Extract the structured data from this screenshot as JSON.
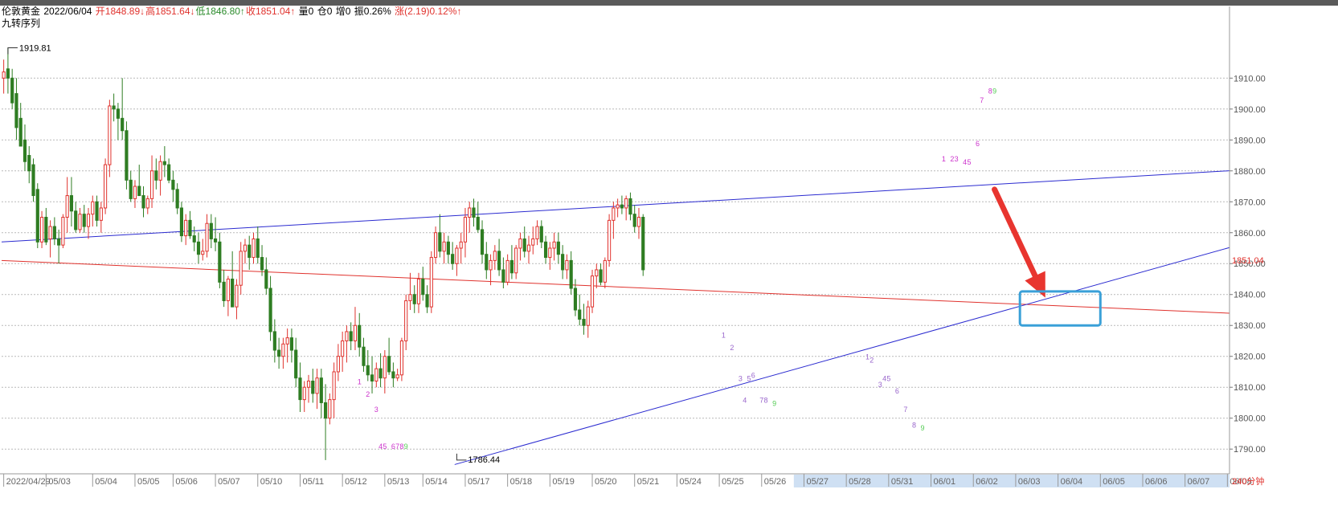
{
  "header": {
    "symbol": "伦敦黄金",
    "date": "2022/06/04",
    "open": "开1848.89↓",
    "high": "高1851.64↓",
    "low": "低1846.80↑",
    "close": "收1851.04↑",
    "volume": "量0",
    "position": "仓0",
    "increase": "增0",
    "amplitude": "振0.26%",
    "change": "涨(2.19)0.12%↑"
  },
  "indicator_label": "九转序列",
  "period_label": "240分钟",
  "price_marker": "1851.04",
  "colors": {
    "up": "#e0322d",
    "down": "#2e7d22",
    "upper_channel": "#2b2bd0",
    "red_line": "#e0322d",
    "arrow": "#e8352f",
    "box": "#3aa0d8",
    "seq_up": "#cc33cc",
    "seq_down": "#9966cc",
    "seq_nine": "#55cc55"
  },
  "chart_data": {
    "type": "candlestick",
    "title": "",
    "xlabel": "",
    "ylabel": "",
    "ylim": [
      1782,
      1928
    ],
    "y_ticks": [
      1790,
      1800,
      1810,
      1820,
      1830,
      1840,
      1850,
      1860,
      1870,
      1880,
      1890,
      1900,
      1910
    ],
    "y_tick_labels": [
      "1790.00",
      "1800.00",
      "1810.00",
      "1820.00",
      "1830.00",
      "1840.00",
      "1850.00",
      "1860.00",
      "1870.00",
      "1880.00",
      "1890.00",
      "1900.00",
      "1910.00"
    ],
    "x_labels": [
      "2022/04/29",
      "05/03",
      "05/04",
      "05/05",
      "05/06",
      "05/07",
      "05/10",
      "05/11",
      "05/12",
      "05/13",
      "05/14",
      "05/17",
      "05/18",
      "05/19",
      "05/20",
      "05/21",
      "05/24",
      "05/25",
      "05/26",
      "05/27",
      "05/28",
      "05/31",
      "06/01",
      "06/02",
      "06/03",
      "06/04",
      "06/05",
      "06/06",
      "06/07",
      "06/08"
    ],
    "x_label_positions": [
      0,
      10,
      21,
      31,
      40,
      50,
      60,
      70,
      80,
      90,
      99,
      109,
      119,
      129,
      139,
      149,
      159,
      169,
      179,
      189,
      199,
      209,
      219,
      229,
      239,
      249,
      259,
      269,
      279,
      289
    ],
    "future_from_label": "05/27",
    "high_annotation": {
      "text": "1919.81",
      "value": 1919.81,
      "index": 1
    },
    "low_annotation": {
      "text": "1786.44",
      "value": 1786.44,
      "index": 107
    },
    "candles": [
      [
        1910,
        1916,
        1905,
        1912
      ],
      [
        1913,
        1919.81,
        1905,
        1910
      ],
      [
        1910,
        1913,
        1900,
        1902
      ],
      [
        1905,
        1910,
        1890,
        1894
      ],
      [
        1897,
        1902,
        1888,
        1888
      ],
      [
        1890,
        1895,
        1880,
        1883
      ],
      [
        1885,
        1888,
        1876,
        1880
      ],
      [
        1882,
        1884,
        1870,
        1872
      ],
      [
        1874,
        1876,
        1855,
        1857
      ],
      [
        1857,
        1867,
        1855,
        1865
      ],
      [
        1865,
        1868,
        1856,
        1857
      ],
      [
        1858,
        1864,
        1852,
        1862
      ],
      [
        1862,
        1865,
        1856,
        1858
      ],
      [
        1858,
        1861,
        1850,
        1856
      ],
      [
        1856,
        1866,
        1855,
        1865
      ],
      [
        1865,
        1878,
        1860,
        1872
      ],
      [
        1872,
        1878,
        1862,
        1867
      ],
      [
        1867,
        1870,
        1860,
        1861
      ],
      [
        1861,
        1868,
        1860,
        1866
      ],
      [
        1866,
        1869,
        1860,
        1862
      ],
      [
        1862,
        1868,
        1858,
        1866
      ],
      [
        1866,
        1872,
        1862,
        1870
      ],
      [
        1870,
        1872,
        1862,
        1864
      ],
      [
        1864,
        1870,
        1860,
        1868
      ],
      [
        1868,
        1884,
        1866,
        1882
      ],
      [
        1882,
        1903,
        1878,
        1901
      ],
      [
        1901,
        1905,
        1896,
        1900
      ],
      [
        1900,
        1902,
        1890,
        1897
      ],
      [
        1897,
        1910,
        1890,
        1893
      ],
      [
        1893,
        1896,
        1874,
        1877
      ],
      [
        1877,
        1880,
        1870,
        1871
      ],
      [
        1871,
        1877,
        1868,
        1875
      ],
      [
        1875,
        1882,
        1872,
        1872
      ],
      [
        1872,
        1875,
        1865,
        1868
      ],
      [
        1868,
        1872,
        1866,
        1871
      ],
      [
        1871,
        1885,
        1868,
        1880
      ],
      [
        1880,
        1884,
        1874,
        1877
      ],
      [
        1877,
        1885,
        1872,
        1883
      ],
      [
        1883,
        1888,
        1878,
        1882
      ],
      [
        1882,
        1884,
        1876,
        1877
      ],
      [
        1877,
        1880,
        1870,
        1874
      ],
      [
        1874,
        1876,
        1866,
        1868
      ],
      [
        1868,
        1870,
        1857,
        1859
      ],
      [
        1859,
        1866,
        1856,
        1864
      ],
      [
        1864,
        1867,
        1858,
        1859
      ],
      [
        1859,
        1862,
        1854,
        1857
      ],
      [
        1857,
        1860,
        1850,
        1853
      ],
      [
        1853,
        1858,
        1851,
        1854
      ],
      [
        1854,
        1866,
        1852,
        1863
      ],
      [
        1863,
        1866,
        1855,
        1858
      ],
      [
        1858,
        1865,
        1854,
        1857
      ],
      [
        1857,
        1860,
        1842,
        1844
      ],
      [
        1844,
        1848,
        1836,
        1838
      ],
      [
        1838,
        1846,
        1833,
        1845
      ],
      [
        1845,
        1854,
        1838,
        1836
      ],
      [
        1836,
        1845,
        1832,
        1843
      ],
      [
        1843,
        1857,
        1840,
        1854
      ],
      [
        1854,
        1858,
        1850,
        1856
      ],
      [
        1856,
        1859,
        1848,
        1852
      ],
      [
        1852,
        1860,
        1850,
        1858
      ],
      [
        1858,
        1862,
        1850,
        1852
      ],
      [
        1852,
        1856,
        1846,
        1848
      ],
      [
        1848,
        1852,
        1840,
        1842
      ],
      [
        1842,
        1846,
        1825,
        1828
      ],
      [
        1828,
        1832,
        1818,
        1822
      ],
      [
        1822,
        1826,
        1816,
        1820
      ],
      [
        1820,
        1826,
        1816,
        1824
      ],
      [
        1824,
        1829,
        1818,
        1826
      ],
      [
        1826,
        1829,
        1818,
        1822
      ],
      [
        1822,
        1826,
        1810,
        1813
      ],
      [
        1813,
        1818,
        1802,
        1806
      ],
      [
        1806,
        1812,
        1802,
        1810
      ],
      [
        1810,
        1814,
        1805,
        1812
      ],
      [
        1812,
        1816,
        1805,
        1808
      ],
      [
        1808,
        1816,
        1803,
        1813
      ],
      [
        1813,
        1816,
        1800,
        1805
      ],
      [
        1805,
        1811,
        1786.44,
        1800
      ],
      [
        1800,
        1808,
        1798,
        1806
      ],
      [
        1806,
        1818,
        1800,
        1815
      ],
      [
        1815,
        1824,
        1812,
        1820
      ],
      [
        1820,
        1828,
        1815,
        1825
      ],
      [
        1825,
        1830,
        1818,
        1828
      ],
      [
        1828,
        1831,
        1822,
        1825
      ],
      [
        1825,
        1836,
        1822,
        1830
      ],
      [
        1830,
        1834,
        1820,
        1823
      ],
      [
        1823,
        1826,
        1815,
        1817
      ],
      [
        1817,
        1822,
        1812,
        1814
      ],
      [
        1814,
        1820,
        1808,
        1812
      ],
      [
        1812,
        1818,
        1810,
        1816
      ],
      [
        1816,
        1821,
        1810,
        1813
      ],
      [
        1813,
        1822,
        1808,
        1820
      ],
      [
        1820,
        1826,
        1814,
        1815
      ],
      [
        1815,
        1818,
        1810,
        1813
      ],
      [
        1813,
        1816,
        1812,
        1814
      ],
      [
        1814,
        1826,
        1812,
        1825
      ],
      [
        1825,
        1840,
        1822,
        1838
      ],
      [
        1838,
        1847,
        1835,
        1840
      ],
      [
        1840,
        1843,
        1834,
        1837
      ],
      [
        1837,
        1847,
        1834,
        1845
      ],
      [
        1845,
        1849,
        1838,
        1840
      ],
      [
        1840,
        1843,
        1834,
        1836
      ],
      [
        1836,
        1854,
        1834,
        1852
      ],
      [
        1852,
        1862,
        1850,
        1860
      ],
      [
        1860,
        1866,
        1852,
        1854
      ],
      [
        1854,
        1860,
        1850,
        1857
      ],
      [
        1857,
        1859,
        1850,
        1853
      ],
      [
        1853,
        1857,
        1848,
        1850
      ],
      [
        1850,
        1856,
        1846,
        1855
      ],
      [
        1855,
        1860,
        1850,
        1857
      ],
      [
        1857,
        1868,
        1852,
        1865
      ],
      [
        1865,
        1870,
        1860,
        1868
      ],
      [
        1868,
        1871,
        1862,
        1865
      ],
      [
        1865,
        1870,
        1860,
        1861
      ],
      [
        1861,
        1864,
        1850,
        1853
      ],
      [
        1853,
        1857,
        1845,
        1848
      ],
      [
        1848,
        1853,
        1843,
        1851
      ],
      [
        1851,
        1856,
        1848,
        1854
      ],
      [
        1854,
        1858,
        1846,
        1848
      ],
      [
        1848,
        1852,
        1842,
        1844
      ],
      [
        1844,
        1853,
        1843,
        1851
      ],
      [
        1851,
        1856,
        1845,
        1847
      ],
      [
        1847,
        1856,
        1845,
        1855
      ],
      [
        1855,
        1860,
        1851,
        1858
      ],
      [
        1858,
        1862,
        1852,
        1854
      ],
      [
        1854,
        1859,
        1850,
        1856
      ],
      [
        1856,
        1862,
        1853,
        1858
      ],
      [
        1858,
        1864,
        1856,
        1862
      ],
      [
        1862,
        1864,
        1855,
        1857
      ],
      [
        1857,
        1859,
        1850,
        1852
      ],
      [
        1852,
        1857,
        1848,
        1855
      ],
      [
        1855,
        1860,
        1851,
        1857
      ],
      [
        1857,
        1860,
        1850,
        1853
      ],
      [
        1853,
        1856,
        1845,
        1848
      ],
      [
        1848,
        1853,
        1845,
        1851
      ],
      [
        1851,
        1854,
        1840,
        1842
      ],
      [
        1842,
        1845,
        1833,
        1835
      ],
      [
        1835,
        1840,
        1830,
        1832
      ],
      [
        1832,
        1837,
        1827,
        1830
      ],
      [
        1830,
        1838,
        1826,
        1836
      ],
      [
        1836,
        1848,
        1834,
        1846
      ],
      [
        1846,
        1850,
        1842,
        1848
      ],
      [
        1848,
        1850,
        1843,
        1844
      ],
      [
        1844,
        1852,
        1842,
        1851
      ],
      [
        1851,
        1866,
        1849,
        1864
      ],
      [
        1864,
        1870,
        1858,
        1868
      ],
      [
        1868,
        1871,
        1865,
        1869
      ],
      [
        1869,
        1872,
        1866,
        1868
      ],
      [
        1868,
        1872,
        1864,
        1871
      ],
      [
        1871,
        1873,
        1864,
        1866
      ],
      [
        1866,
        1869,
        1860,
        1862
      ],
      [
        1862,
        1868,
        1858,
        1865
      ],
      [
        1865,
        1866,
        1846,
        1848
      ]
    ],
    "trendlines": [
      {
        "name": "",
        "color": "#2b2bd0",
        "from": [
          0,
          1857
        ],
        "to": [
          289,
          1880
        ]
      },
      {
        "name": "",
        "color": "#e0322d",
        "from": [
          0,
          1851
        ],
        "to": [
          289,
          1834
        ]
      },
      {
        "name": "",
        "color": "#2b2bd0",
        "from": [
          107,
          1785
        ],
        "to": [
          289,
          1855
        ]
      }
    ],
    "sequence_labels": [
      {
        "t": "1",
        "i": 84,
        "v": 1811,
        "c": "#cc33cc"
      },
      {
        "t": "2",
        "i": 86,
        "v": 1807,
        "c": "#cc33cc"
      },
      {
        "t": "3",
        "i": 88,
        "v": 1802,
        "c": "#cc33cc"
      },
      {
        "t": "4",
        "i": 89,
        "v": 1790,
        "c": "#cc33cc"
      },
      {
        "t": "5",
        "i": 90,
        "v": 1790,
        "c": "#cc33cc"
      },
      {
        "t": "6",
        "i": 92,
        "v": 1790,
        "c": "#cc33cc"
      },
      {
        "t": "7",
        "i": 93,
        "v": 1790,
        "c": "#cc33cc"
      },
      {
        "t": "8",
        "i": 94,
        "v": 1790,
        "c": "#cc33cc"
      },
      {
        "t": "9",
        "i": 95,
        "v": 1790,
        "c": "#55cc55"
      },
      {
        "t": "1",
        "i": 170,
        "v": 1826,
        "c": "#9966cc"
      },
      {
        "t": "2",
        "i": 172,
        "v": 1822,
        "c": "#9966cc"
      },
      {
        "t": "3",
        "i": 174,
        "v": 1812,
        "c": "#9966cc"
      },
      {
        "t": "4",
        "i": 175,
        "v": 1805,
        "c": "#9966cc"
      },
      {
        "t": "5",
        "i": 176,
        "v": 1812,
        "c": "#9966cc"
      },
      {
        "t": "6",
        "i": 177,
        "v": 1813,
        "c": "#9966cc"
      },
      {
        "t": "7",
        "i": 179,
        "v": 1805,
        "c": "#9966cc"
      },
      {
        "t": "8",
        "i": 180,
        "v": 1805,
        "c": "#9966cc"
      },
      {
        "t": "9",
        "i": 182,
        "v": 1804,
        "c": "#55cc55"
      },
      {
        "t": "1",
        "i": 204,
        "v": 1819,
        "c": "#9966cc"
      },
      {
        "t": "2",
        "i": 205,
        "v": 1818,
        "c": "#9966cc"
      },
      {
        "t": "3",
        "i": 207,
        "v": 1810,
        "c": "#9966cc"
      },
      {
        "t": "4",
        "i": 208,
        "v": 1812,
        "c": "#9966cc"
      },
      {
        "t": "5",
        "i": 209,
        "v": 1812,
        "c": "#9966cc"
      },
      {
        "t": "6",
        "i": 211,
        "v": 1808,
        "c": "#9966cc"
      },
      {
        "t": "7",
        "i": 213,
        "v": 1802,
        "c": "#9966cc"
      },
      {
        "t": "8",
        "i": 215,
        "v": 1797,
        "c": "#9966cc"
      },
      {
        "t": "9",
        "i": 217,
        "v": 1796,
        "c": "#55cc55"
      },
      {
        "t": "1",
        "i": 222,
        "v": 1883,
        "c": "#cc33cc"
      },
      {
        "t": "2",
        "i": 224,
        "v": 1883,
        "c": "#cc33cc"
      },
      {
        "t": "3",
        "i": 225,
        "v": 1883,
        "c": "#cc33cc"
      },
      {
        "t": "4",
        "i": 227,
        "v": 1882,
        "c": "#cc33cc"
      },
      {
        "t": "5",
        "i": 228,
        "v": 1882,
        "c": "#cc33cc"
      },
      {
        "t": "6",
        "i": 230,
        "v": 1888,
        "c": "#cc33cc"
      },
      {
        "t": "7",
        "i": 231,
        "v": 1902,
        "c": "#cc33cc"
      },
      {
        "t": "8",
        "i": 233,
        "v": 1905,
        "c": "#cc33cc"
      },
      {
        "t": "9",
        "i": 234,
        "v": 1905,
        "c": "#55cc55"
      }
    ],
    "arrow": {
      "from": [
        234,
        1874
      ],
      "to": [
        246,
        1839
      ]
    },
    "target_box": {
      "from": [
        240,
        1841
      ],
      "to": [
        259,
        1830
      ]
    }
  }
}
